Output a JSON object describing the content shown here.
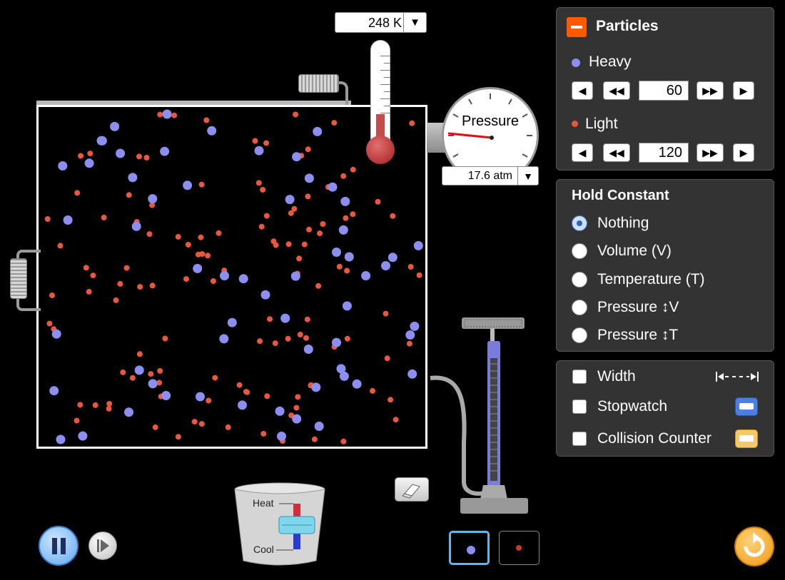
{
  "thermometer": {
    "value": "248 K",
    "dropdown_icon": "triangle-down-icon"
  },
  "gauge": {
    "label": "Pressure",
    "value": "17.6 atm",
    "dropdown_icon": "triangle-down-icon"
  },
  "particles_panel": {
    "title": "Particles",
    "heavy": {
      "label": "Heavy",
      "value": "60",
      "color": "#8d8ff0"
    },
    "light": {
      "label": "Light",
      "value": "120",
      "color": "#e8573e"
    }
  },
  "hold_constant": {
    "title": "Hold Constant",
    "selected": "Nothing",
    "options": [
      "Nothing",
      "Volume (V)",
      "Temperature (T)",
      "Pressure ↕V",
      "Pressure ↕T"
    ]
  },
  "tools": {
    "width": {
      "label": "Width",
      "icon": "width-arrows-icon"
    },
    "stopwatch": {
      "label": "Stopwatch",
      "icon": "stopwatch-icon"
    },
    "collision_counter": {
      "label": "Collision Counter",
      "icon": "counter-icon"
    }
  },
  "bucket": {
    "heat_label": "Heat",
    "cool_label": "Cool"
  },
  "colors": {
    "heavy": "#8d8ff0",
    "light": "#e8573e",
    "accent": "#ff5a00",
    "panel": "#333333"
  }
}
